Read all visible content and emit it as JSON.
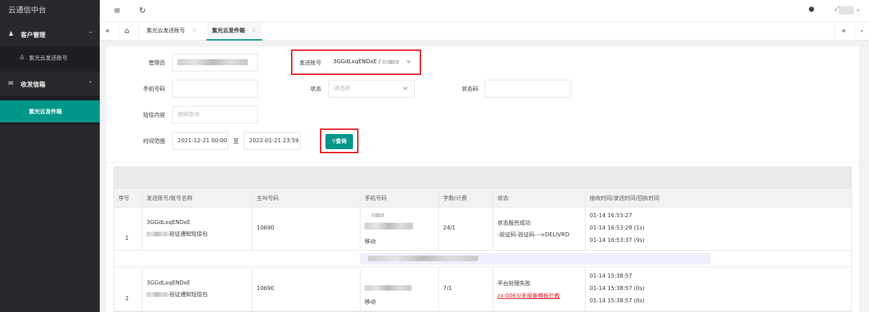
{
  "app": {
    "title": "云通信中台"
  },
  "sidebar": {
    "groups": [
      {
        "label": "客户管理",
        "icon": "user-icon",
        "items": [
          {
            "label": "紫光云发送账号",
            "icon": "account-icon",
            "active": false
          }
        ]
      },
      {
        "label": "收发信箱",
        "icon": "inbox-icon",
        "items": [
          {
            "label": "紫光云发件箱",
            "active": true
          }
        ]
      }
    ]
  },
  "header": {
    "icons": [
      "menu-fold-icon",
      "refresh-icon",
      "theme-icon",
      "fullscreen-icon"
    ]
  },
  "tabs": [
    {
      "label": "紫光云发送账号",
      "active": false
    },
    {
      "label": "紫光云发件箱",
      "active": true
    }
  ],
  "form": {
    "admin_label": "管理员",
    "send_account_label": "发送账号",
    "send_account_value": "3GGdLxqENDxE /",
    "phone_label": "手机号码",
    "status_label": "状态",
    "status_placeholder": "请选择",
    "status_code_label": "状态码",
    "sms_content_label": "短信内容",
    "sms_content_placeholder": "模糊查询",
    "time_range_label": "时间范围",
    "start_time": "2021-12-21 00:00",
    "to_label": "至",
    "end_time": "2022-01-21 23:59",
    "query_label": "查询"
  },
  "table": {
    "columns": [
      "序号",
      "发送账号/账号名称",
      "主叫号码",
      "手机号码",
      "字数/计费",
      "状态",
      "接收时间/发送时间/回执时间"
    ],
    "rows": [
      {
        "index": "1",
        "account": "3GGdLxqENDxE",
        "account_name": "-验证通知短信包",
        "caller": "10690",
        "carrier": "移动",
        "count": "24/1",
        "status": "状态报告成功",
        "status_detail": "-验证码-验证码--->DELIVRD",
        "status_error": false,
        "times": [
          "01-14 16:53:27",
          "01-14 16:53:28 (1s)",
          "01-14 16:53:37 (9s)"
        ]
      },
      {
        "index": "2",
        "account": "3GGdLxqENDxE",
        "account_name": "-验证通知短信包",
        "caller": "10690",
        "carrier": "移动",
        "count": "7/1",
        "status": "平台处理失败",
        "status_detail": "zx:0063/未报备模板拦截",
        "status_error": true,
        "times": [
          "01-14 15:38:57",
          "01-14 15:38:57 (0s)",
          "01-14 15:38:57 (0s)"
        ]
      }
    ]
  },
  "colors": {
    "sidebar_bg": "#28292d",
    "accent": "#009688",
    "highlight_box": "#e8161d",
    "error_text": "#e8161d"
  }
}
